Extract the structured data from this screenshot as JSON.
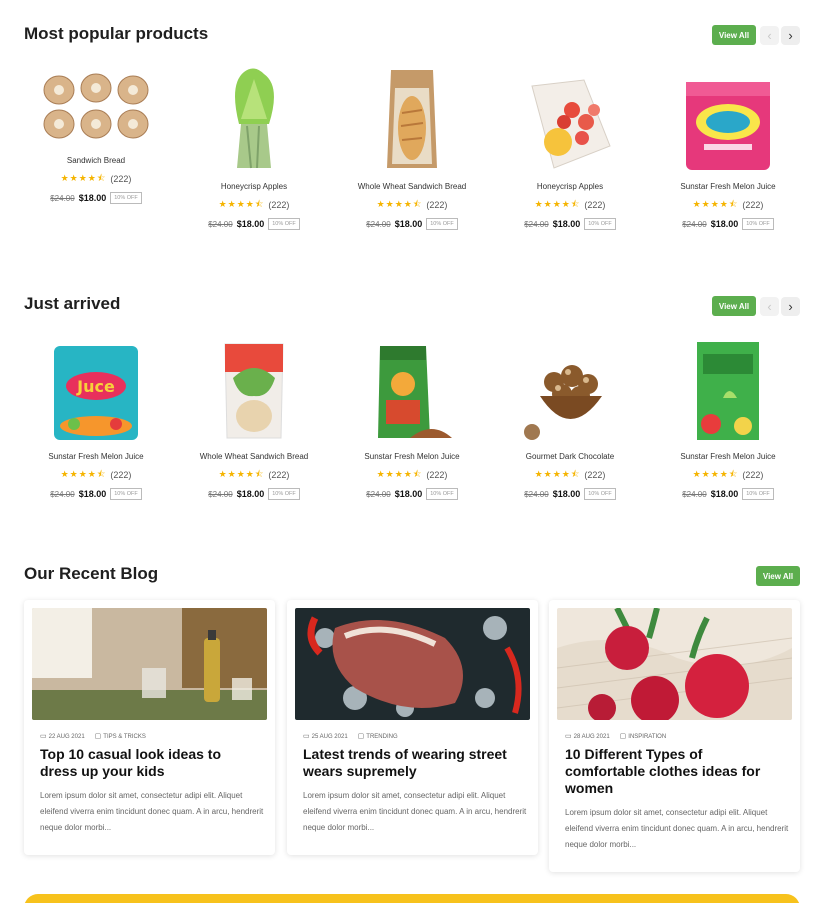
{
  "popular": {
    "title": "Most popular products",
    "view_all": "View All",
    "products": [
      {
        "name": "Sandwich Bread",
        "reviews": "(222)",
        "old_price": "$24.00",
        "price": "$18.00",
        "discount": "10% OFF",
        "image": "mushroom-icon"
      },
      {
        "name": "Honeycrisp Apples",
        "reviews": "(222)",
        "old_price": "$24.00",
        "price": "$18.00",
        "discount": "10% OFF",
        "image": "lettuce-icon"
      },
      {
        "name": "Whole Wheat Sandwich Bread",
        "reviews": "(222)",
        "old_price": "$24.00",
        "price": "$18.00",
        "discount": "10% OFF",
        "image": "bread-bag-icon"
      },
      {
        "name": "Honeycrisp Apples",
        "reviews": "(222)",
        "old_price": "$24.00",
        "price": "$18.00",
        "discount": "10% OFF",
        "image": "fruit-bag-icon"
      },
      {
        "name": "Sunstar Fresh Melon Juice",
        "reviews": "(222)",
        "old_price": "$24.00",
        "price": "$18.00",
        "discount": "10% OFF",
        "image": "juice-pack-icon"
      }
    ]
  },
  "arrived": {
    "title": "Just arrived",
    "view_all": "View All",
    "products": [
      {
        "name": "Sunstar Fresh Melon Juice",
        "reviews": "(222)",
        "old_price": "$24.00",
        "price": "$18.00",
        "discount": "10% OFF",
        "image": "juice-box-icon"
      },
      {
        "name": "Whole Wheat Sandwich Bread",
        "reviews": "(222)",
        "old_price": "$24.00",
        "price": "$18.00",
        "discount": "10% OFF",
        "image": "snack-bag-icon"
      },
      {
        "name": "Sunstar Fresh Melon Juice",
        "reviews": "(222)",
        "old_price": "$24.00",
        "price": "$18.00",
        "discount": "10% OFF",
        "image": "spice-bag-icon"
      },
      {
        "name": "Gourmet Dark Chocolate",
        "reviews": "(222)",
        "old_price": "$24.00",
        "price": "$18.00",
        "discount": "10% OFF",
        "image": "chocolate-bowl-icon"
      },
      {
        "name": "Sunstar Fresh Melon Juice",
        "reviews": "(222)",
        "old_price": "$24.00",
        "price": "$18.00",
        "discount": "10% OFF",
        "image": "green-pack-icon"
      }
    ]
  },
  "blog": {
    "title": "Our Recent Blog",
    "view_all": "View All",
    "posts": [
      {
        "date": "22 AUG 2021",
        "category": "TIPS & TRICKS",
        "title": "Top 10 casual look ideas to dress up your kids",
        "excerpt": "Lorem ipsum dolor sit amet, consectetur adipi elit. Aliquet eleifend viverra enim tincidunt donec quam. A in arcu, hendrerit neque dolor morbi...",
        "image": "dining-table-photo"
      },
      {
        "date": "25 AUG 2021",
        "category": "TRENDING",
        "title": "Latest trends of wearing street wears supremely",
        "excerpt": "Lorem ipsum dolor sit amet, consectetur adipi elit. Aliquet eleifend viverra enim tincidunt donec quam. A in arcu, hendrerit neque dolor morbi...",
        "image": "steak-photo"
      },
      {
        "date": "28 AUG 2021",
        "category": "INSPIRATION",
        "title": "10 Different Types of comfortable clothes ideas for women",
        "excerpt": "Lorem ipsum dolor sit amet, consectetur adipi elit. Aliquet eleifend viverra enim tincidunt donec quam. A in arcu, hendrerit neque dolor morbi...",
        "image": "radish-photo"
      }
    ]
  },
  "colors": {
    "accent": "#5cae4e",
    "star": "#f5b400",
    "banner": "#f7c21c"
  },
  "icons": {
    "prev": "‹",
    "next": "›",
    "calendar": "calendar-icon",
    "folder": "folder-icon"
  }
}
